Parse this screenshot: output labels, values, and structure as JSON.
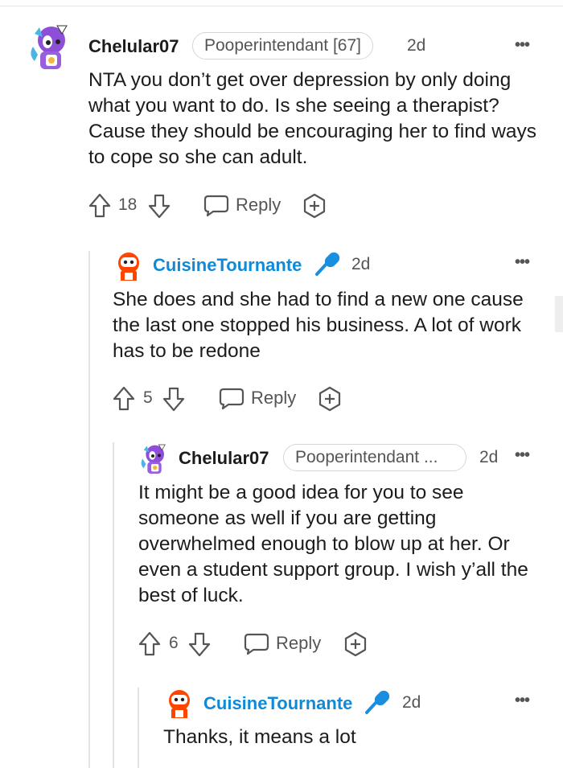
{
  "comments": [
    {
      "username": "Chelular07",
      "flair": "Pooperintendant [67]",
      "age": "2d",
      "text": "NTA you don’t get over depression by only doing what you want to do. Is she seeing a therapist? Cause they should be encouraging her to find ways to cope so she can adult.",
      "votes": "18",
      "reply_label": "Reply"
    },
    {
      "username": "CuisineTournante",
      "age": "2d",
      "text": "She does and she had to find a new one cause the last one stopped his business. A lot of work has to be redone",
      "votes": "5",
      "reply_label": "Reply"
    },
    {
      "username": "Chelular07",
      "flair": "Pooperintendant ...",
      "age": "2d",
      "text": "It might be a good idea for you to see someone as well if you are getting overwhelmed enough to blow up at her. Or even a student support group. I wish y’all the best of luck.",
      "votes": "6",
      "reply_label": "Reply"
    },
    {
      "username": "CuisineTournante",
      "age": "2d",
      "text": "Thanks, it means a lot"
    }
  ],
  "more_label": "•••",
  "icons": {
    "upvote": "upvote-arrow-icon",
    "downvote": "downvote-arrow-icon",
    "reply": "speech-bubble-icon",
    "award": "award-plus-icon",
    "mod_mic": "microphone-icon",
    "more": "more-options-icon"
  },
  "colors": {
    "username_blue": "#0f8ad8",
    "mic_blue": "#1a8fe0",
    "muted": "#555555"
  }
}
